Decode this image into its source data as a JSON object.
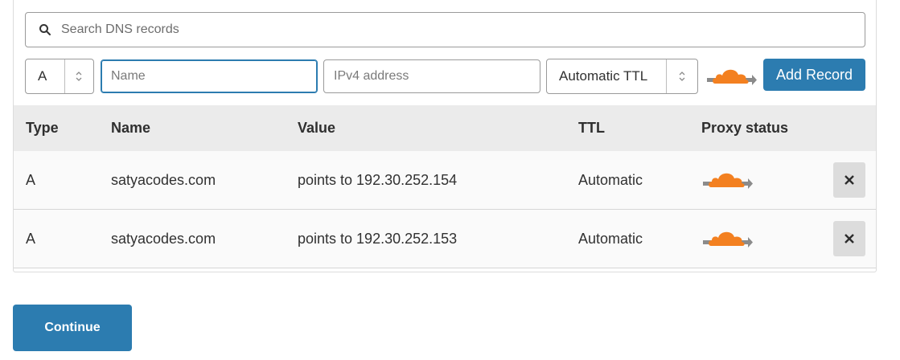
{
  "search": {
    "placeholder": "Search DNS records",
    "icon": "search-icon"
  },
  "form": {
    "type_value": "A",
    "name_placeholder": "Name",
    "ipv4_placeholder": "IPv4 address",
    "ttl_value": "Automatic TTL",
    "proxy_icon": "cloud-proxied-icon",
    "add_label": "Add Record"
  },
  "table": {
    "headers": [
      "Type",
      "Name",
      "Value",
      "TTL",
      "Proxy status"
    ],
    "rows": [
      {
        "type": "A",
        "name": "satyacodes.com",
        "value": "points to 192.30.252.154",
        "ttl": "Automatic",
        "proxy_icon": "cloud-proxied-icon",
        "delete_icon": "close-icon"
      },
      {
        "type": "A",
        "name": "satyacodes.com",
        "value": "points to 192.30.252.153",
        "ttl": "Automatic",
        "proxy_icon": "cloud-proxied-icon",
        "delete_icon": "close-icon"
      }
    ]
  },
  "continue_label": "Continue",
  "colors": {
    "accent": "#2c7cb0",
    "cloud": "#f38020",
    "arrow": "#8b8b8b",
    "header_bg": "#ebebeb"
  }
}
